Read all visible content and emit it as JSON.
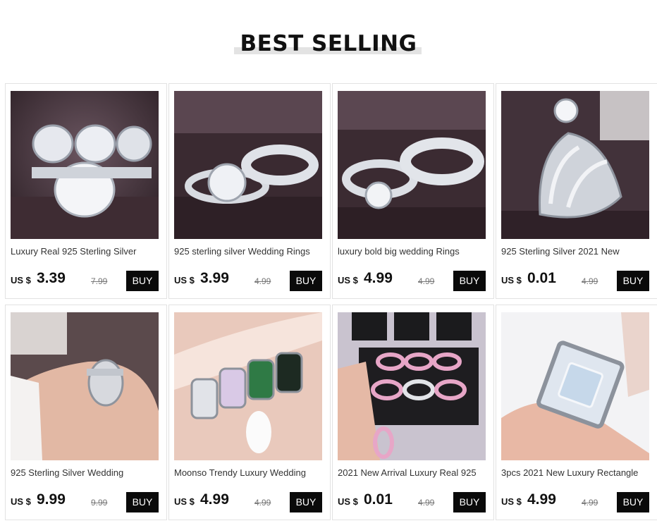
{
  "heading": "BEST SELLING",
  "products": [
    {
      "title": "Luxury  Real 925 Sterling Silver",
      "currency": "US $",
      "price": "3.39",
      "old_price": "7.99",
      "buy_label": "BUY",
      "image_icon": "ring-photo-icon"
    },
    {
      "title": "925 sterling silver Wedding Rings",
      "currency": "US $",
      "price": "3.99",
      "old_price": "4.99",
      "buy_label": "BUY",
      "image_icon": "ring-photo-icon"
    },
    {
      "title": "luxury bold big wedding Rings",
      "currency": "US $",
      "price": "4.99",
      "old_price": "4.99",
      "buy_label": "BUY",
      "image_icon": "ring-photo-icon"
    },
    {
      "title": "925 Sterling Silver 2021 New",
      "currency": "US $",
      "price": "0.01",
      "old_price": "4.99",
      "buy_label": "BUY",
      "image_icon": "ring-photo-icon"
    },
    {
      "title": "925 Sterling Silver Wedding",
      "currency": "US $",
      "price": "9.99",
      "old_price": "9.99",
      "buy_label": "BUY",
      "image_icon": "ring-photo-icon"
    },
    {
      "title": "Moonso Trendy Luxury Wedding",
      "currency": "US $",
      "price": "4.99",
      "old_price": "4.99",
      "buy_label": "BUY",
      "image_icon": "ring-photo-icon"
    },
    {
      "title": "2021 New Arrival Luxury Real 925",
      "currency": "US $",
      "price": "0.01",
      "old_price": "4.99",
      "buy_label": "BUY",
      "image_icon": "ring-photo-icon"
    },
    {
      "title": "3pcs 2021 New Luxury Rectangle",
      "currency": "US $",
      "price": "4.99",
      "old_price": "4.99",
      "buy_label": "BUY",
      "image_icon": "ring-photo-icon"
    }
  ],
  "colors": {
    "button_bg": "#0a0a0a",
    "button_text": "#ffffff",
    "heading_bar": "#e3e3e3"
  }
}
